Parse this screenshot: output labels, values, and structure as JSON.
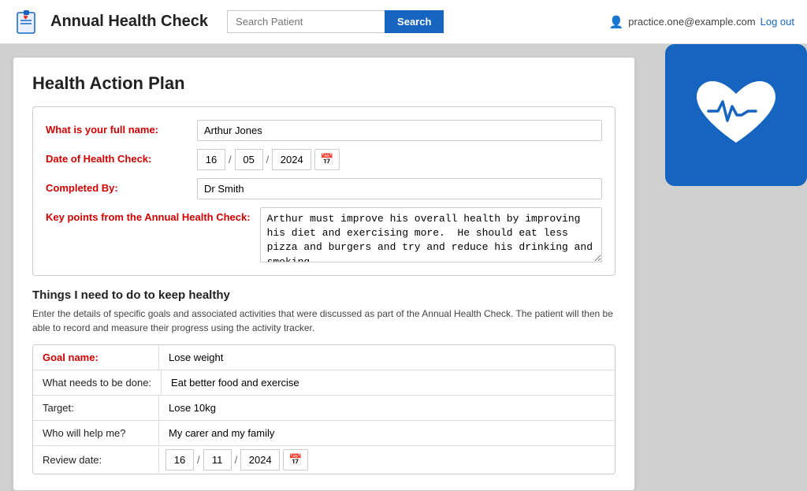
{
  "app": {
    "title": "Annual Health Check",
    "search_placeholder": "Search Patient",
    "search_button": "Search"
  },
  "user": {
    "email": "practice.one@example.com",
    "logout_label": "Log out"
  },
  "page": {
    "title": "Health Action Plan"
  },
  "form": {
    "full_name_label": "What is your full name:",
    "full_name_value": "Arthur Jones",
    "date_label": "Date of Health Check:",
    "date_day": "16",
    "date_month": "05",
    "date_year": "2024",
    "completed_by_label": "Completed By:",
    "completed_by_value": "Dr Smith",
    "key_points_label": "Key points from the Annual Health Check:",
    "key_points_value": "Arthur must improve his overall health by improving his diet and exercising more.  He should eat less pizza and burgers and try and reduce his drinking and smoking."
  },
  "goals": {
    "section_title": "Things I need to do to keep healthy",
    "section_desc": "Enter the details of specific goals and associated activities that were discussed as part of the Annual Health Check. The patient will then be able to record and measure their progress using the activity tracker.",
    "goal_name_label": "Goal name:",
    "goal_name_value": "Lose weight",
    "what_needs_label": "What needs to be done:",
    "what_needs_value": "Eat better food and exercise",
    "target_label": "Target:",
    "target_value": "Lose 10kg",
    "who_help_label": "Who will help me?",
    "who_help_value": "My carer and my family",
    "review_date_label": "Review date:",
    "review_day": "16",
    "review_month": "11",
    "review_year": "2024"
  }
}
